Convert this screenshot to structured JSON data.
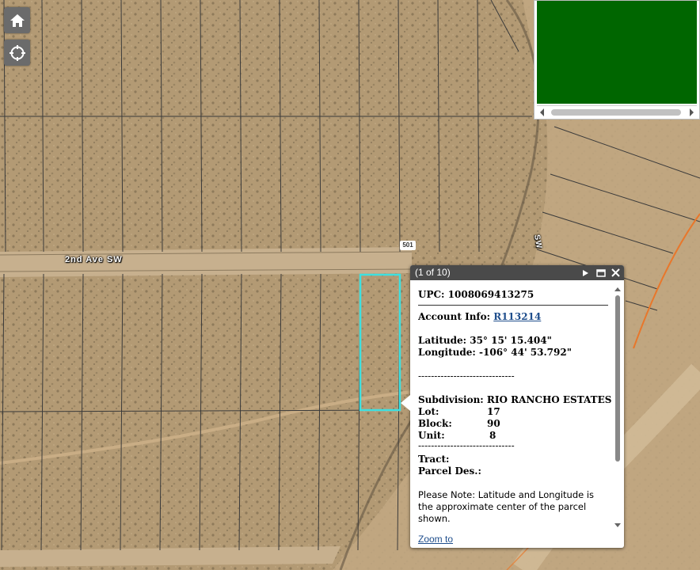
{
  "map": {
    "street_labels": [
      "2nd Ave SW",
      "SW"
    ],
    "route_shield": "501",
    "parcel_line_color": "#3a3a3a",
    "highlight_color": "#3ee0e0",
    "ground_color": "#b39a74"
  },
  "controls": {
    "home_icon": "home-icon",
    "locate_icon": "locate-icon"
  },
  "overview": {
    "color": "#006600"
  },
  "popup": {
    "counter": "(1 of 10)",
    "upc_label": "UPC:",
    "upc_value": "1008069413275",
    "account_label": "Account Info:",
    "account_value": "R113214",
    "latitude_label": "Latitude:",
    "latitude_value": "35° 15' 15.404\"",
    "longitude_label": "Longitude:",
    "longitude_value": "-106° 44' 53.792\"",
    "dashes1": "------------------------------",
    "subdivision_label": "Subdivision:",
    "subdivision_value": "RIO RANCHO ESTATES",
    "lot_label": "Lot:",
    "lot_value": "17",
    "block_label": "Block:",
    "block_value": "90",
    "unit_label": "Unit:",
    "unit_value": "8",
    "dashes2": "------------------------------",
    "tract_label": "Tract:",
    "parcel_des_label": "Parcel Des.:",
    "note_line1": "Please Note: Latitude and Longitude is",
    "note_line2": "the approximate center of the parcel",
    "note_line3": "shown.",
    "zoom_label": "Zoom to"
  }
}
